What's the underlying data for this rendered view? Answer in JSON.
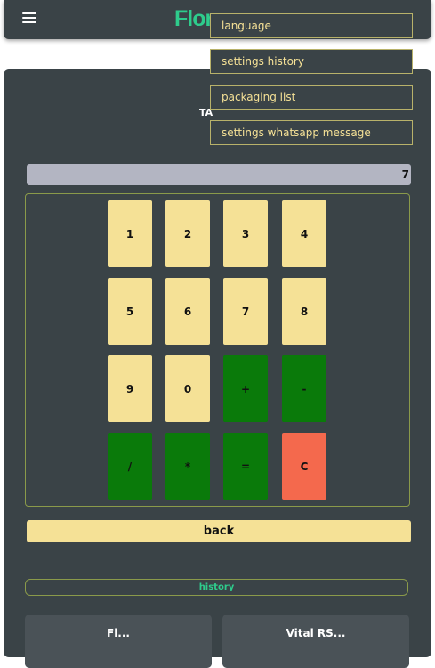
{
  "header": {
    "brand": "Flor",
    "menu_icon": "hamburger-menu-icon"
  },
  "title": "TA",
  "calculator": {
    "display_value": "7",
    "keys": [
      {
        "label": "1",
        "kind": "num"
      },
      {
        "label": "2",
        "kind": "num"
      },
      {
        "label": "3",
        "kind": "num"
      },
      {
        "label": "4",
        "kind": "num"
      },
      {
        "label": "5",
        "kind": "num"
      },
      {
        "label": "6",
        "kind": "num"
      },
      {
        "label": "7",
        "kind": "num"
      },
      {
        "label": "8",
        "kind": "num"
      },
      {
        "label": "9",
        "kind": "num"
      },
      {
        "label": "0",
        "kind": "num"
      },
      {
        "label": "+",
        "kind": "op"
      },
      {
        "label": "-",
        "kind": "op"
      },
      {
        "label": "/",
        "kind": "op"
      },
      {
        "label": "*",
        "kind": "op"
      },
      {
        "label": "=",
        "kind": "op"
      },
      {
        "label": "C",
        "kind": "clear"
      }
    ]
  },
  "back_label": "back",
  "history_label": "history",
  "bottom_cards": [
    "Fl...",
    "Vital RS..."
  ],
  "dropdown": {
    "items": [
      "language",
      "settings history",
      "packaging list",
      "settings whatsapp message"
    ]
  },
  "colors": {
    "panel": "#3a4347",
    "num_key": "#f5e196",
    "op_key": "#0a7a0a",
    "clear_key": "#f4694d",
    "accent": "#2ecc8c"
  }
}
